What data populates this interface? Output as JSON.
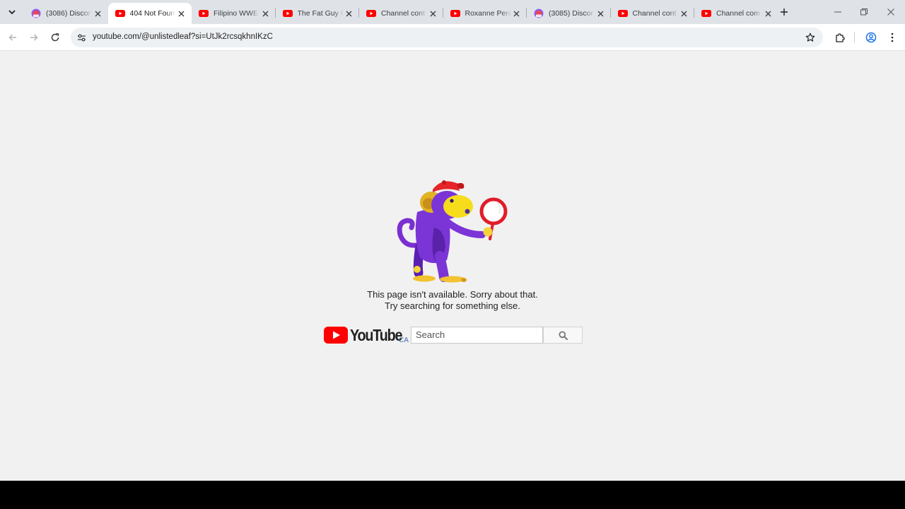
{
  "browser": {
    "tabs": [
      {
        "title": "(3086) Discor",
        "favicon": "discord-avatar-icon",
        "active": false
      },
      {
        "title": "404 Not Foun",
        "favicon": "youtube-icon",
        "active": true
      },
      {
        "title": "Filipino WWE",
        "favicon": "youtube-icon",
        "active": false
      },
      {
        "title": "The Fat Guy C",
        "favicon": "youtube-icon",
        "active": false
      },
      {
        "title": "Channel cont",
        "favicon": "youtube-icon",
        "active": false
      },
      {
        "title": "Roxanne Pere",
        "favicon": "youtube-icon",
        "active": false
      },
      {
        "title": "(3085) Discor",
        "favicon": "discord-avatar-icon",
        "active": false
      },
      {
        "title": "Channel cont",
        "favicon": "youtube-icon",
        "active": false
      },
      {
        "title": "Channel com",
        "favicon": "youtube-icon",
        "active": false
      }
    ],
    "address_bar": {
      "url": "youtube.com/@unlistedleaf?si=UtJk2rcsqkhnIKzC"
    },
    "colors": {
      "tabstrip_bg": "#dfe3e8",
      "youtube_red": "#ff0000"
    }
  },
  "page": {
    "message_line1": "This page isn't available. Sorry about that.",
    "message_line2": "Try searching for something else.",
    "logo_text": "YouTube",
    "country_code": "CA",
    "search_placeholder": "Search"
  }
}
